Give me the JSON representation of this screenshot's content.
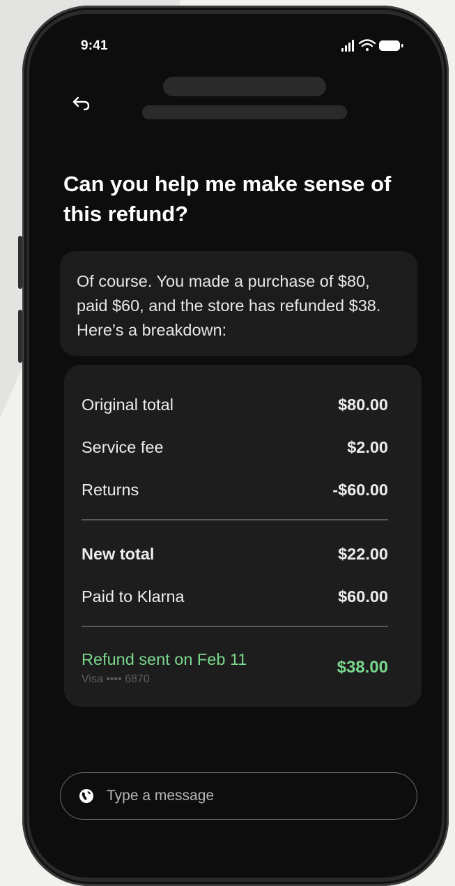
{
  "status_bar": {
    "time": "9:41",
    "icons": [
      "signal-icon",
      "wifi-icon",
      "battery-icon"
    ]
  },
  "header": {
    "back_icon": "back-arrow-icon"
  },
  "conversation": {
    "question": "Can you help me make sense of this refund?",
    "answer": "Of course. You made a purchase of $80, paid $60, and the store has refunded $38. Here’s a breakdown:"
  },
  "breakdown": {
    "items": [
      {
        "label": "Original total",
        "value": "$80.00"
      },
      {
        "label": "Service fee",
        "value": "$2.00"
      },
      {
        "label": "Returns",
        "value": "-$60.00"
      }
    ],
    "totals": [
      {
        "label": "New total",
        "value": "$22.00"
      },
      {
        "label": "Paid to Klarna",
        "value": "$60.00"
      }
    ],
    "refund": {
      "label": "Refund sent on Feb 11",
      "method": "Visa •••• 6870",
      "value": "$38.00"
    }
  },
  "composer": {
    "placeholder": "Type a message",
    "icon": "globe-icon"
  },
  "colors": {
    "accent_green": "#7ad78c",
    "background": "#0d0d0d",
    "card": "#1d1d1d"
  }
}
